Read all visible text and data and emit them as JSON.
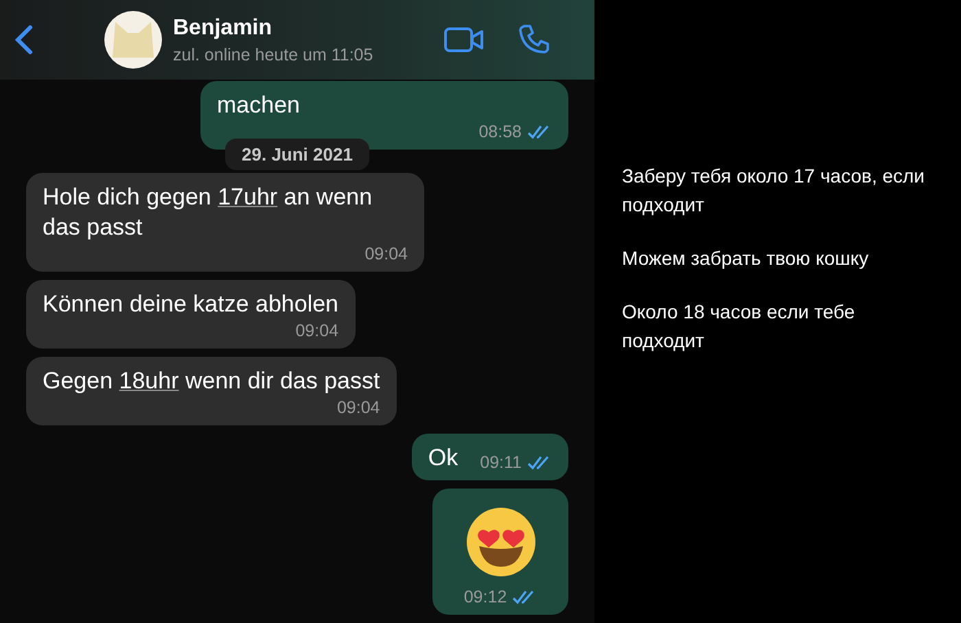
{
  "header": {
    "contact": {
      "name": "Benjamin",
      "status": "zul. online heute um 11:05"
    }
  },
  "messages": [
    {
      "kind": "out",
      "segments": [
        {
          "kind": "plain",
          "text": "machen"
        }
      ],
      "time": "08:58",
      "read": true
    },
    {
      "kind": "date",
      "label": "29. Juni 2021"
    },
    {
      "kind": "in",
      "segments": [
        {
          "kind": "plain",
          "text": "Hole dich gegen "
        },
        {
          "kind": "link",
          "text": "17uhr"
        },
        {
          "kind": "plain",
          "text": " an wenn das passt"
        }
      ],
      "time": "09:04"
    },
    {
      "kind": "in",
      "segments": [
        {
          "kind": "plain",
          "text": "Können deine katze abholen"
        }
      ],
      "time": "09:04"
    },
    {
      "kind": "in",
      "segments": [
        {
          "kind": "plain",
          "text": "Gegen "
        },
        {
          "kind": "link",
          "text": "18uhr"
        },
        {
          "kind": "plain",
          "text": " wenn dir das passt"
        }
      ],
      "time": "09:04"
    },
    {
      "kind": "out",
      "segments": [
        {
          "kind": "plain",
          "text": "Ok"
        }
      ],
      "time": "09:11",
      "read": true
    },
    {
      "kind": "emoji",
      "time": "09:12",
      "read": true
    }
  ],
  "translation": [
    "Заберу тебя около 17 часов, если подходит",
    "Можем забрать твою кошку",
    "Около 18 часов если тебе подходит"
  ]
}
